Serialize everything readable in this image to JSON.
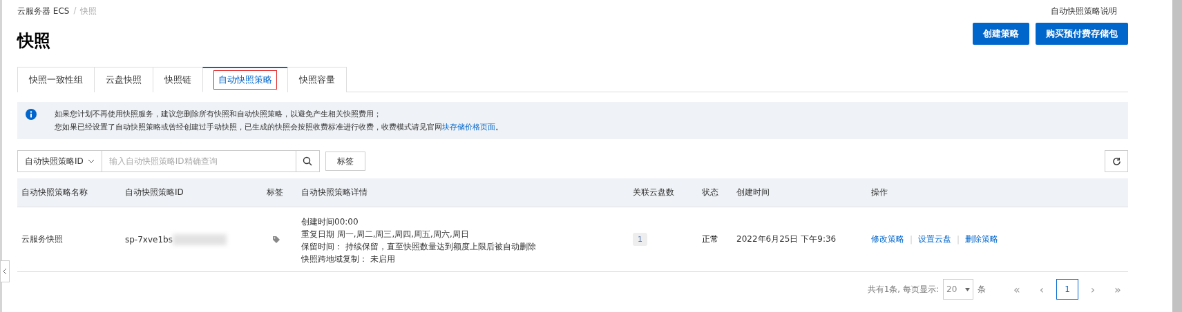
{
  "breadcrumb": [
    {
      "label": "云服务器 ECS",
      "current": false
    },
    {
      "label": "快照",
      "current": true
    }
  ],
  "separator": "/",
  "help_link": "自动快照策略说明",
  "title": "快照",
  "header_buttons": [
    "创建策略",
    "购买预付费存储包"
  ],
  "tabs": [
    {
      "label": "快照一致性组",
      "selected": false,
      "highlighted": false
    },
    {
      "label": "云盘快照",
      "selected": false,
      "highlighted": false
    },
    {
      "label": "快照链",
      "selected": false,
      "highlighted": false
    },
    {
      "label": "自动快照策略",
      "selected": true,
      "highlighted": true
    },
    {
      "label": "快照容量",
      "selected": false,
      "highlighted": false
    }
  ],
  "notice": {
    "lines": [
      {
        "text": "如果您计划不再使用快照服务，建议您删除所有快照和自动快照策略，以避免产生相关快照费用；"
      },
      {
        "text": "您如果已经设置了自动快照策略或曾经创建过手动快照，已生成的快照会按照收费标准进行收费，收费模式请见官网",
        "link": "块存储价格页面",
        "after": "。"
      }
    ]
  },
  "filter": {
    "select": "自动快照策略ID",
    "placeholder": "输入自动快照策略ID精确查询",
    "tag_button": "标签"
  },
  "table": {
    "columns": [
      "自动快照策略名称",
      "自动快照策略ID",
      "标签",
      "自动快照策略详情",
      "关联云盘数",
      "状态",
      "创建时间",
      "操作"
    ],
    "rows": [
      {
        "name": "云服务快照",
        "id": "sp-7xve1bs",
        "id_redacted": true,
        "details": [
          "创建时间00:00",
          "重复日期 周一,周二,周三,周四,周五,周六,周日",
          "保留时间： 持续保留，直至快照数量达到额度上限后被自动删除",
          "快照跨地域复制： 未启用"
        ],
        "disks": "1",
        "status": "正常",
        "created": "2022年6月25日 下午9:36",
        "actions": [
          "修改策略",
          "设置云盘",
          "删除策略"
        ],
        "action_separator": "|"
      }
    ]
  },
  "pagination": {
    "summary": "共有1条, 每页显示:",
    "page_size": "20",
    "unit": "条",
    "first": "«",
    "prev": "‹",
    "pages": [
      {
        "label": "1",
        "selected": true
      }
    ],
    "next": "›",
    "last": "»"
  }
}
